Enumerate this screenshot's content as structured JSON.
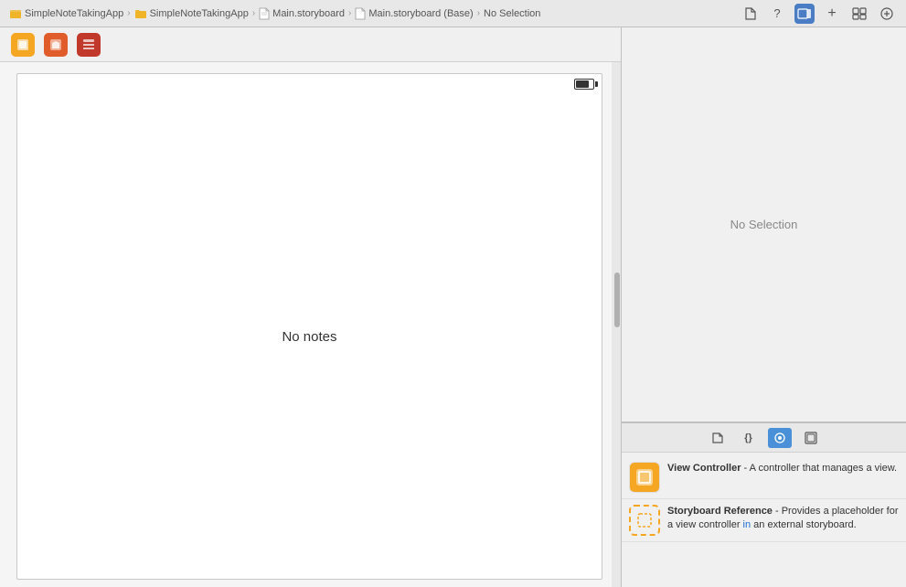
{
  "topBar": {
    "breadcrumb": [
      {
        "label": "SimpleNoteTakingApp",
        "type": "app",
        "iconType": "folder"
      },
      {
        "label": "SimpleNoteTakingApp",
        "type": "folder",
        "iconType": "folder"
      },
      {
        "label": "Main.storyboard",
        "type": "file",
        "iconType": "file"
      },
      {
        "label": "Main.storyboard (Base)",
        "type": "file",
        "iconType": "file"
      },
      {
        "label": "No Selection",
        "type": "text",
        "iconType": "none"
      }
    ],
    "buttons": [
      {
        "icon": "□",
        "label": "new-file",
        "active": false
      },
      {
        "icon": "?",
        "label": "help",
        "active": false
      },
      {
        "icon": "≡",
        "label": "inspector-toggle",
        "active": true
      },
      {
        "icon": "+",
        "label": "add",
        "active": false
      },
      {
        "icon": "⊞",
        "label": "library",
        "active": false
      },
      {
        "icon": "⊕",
        "label": "zoom",
        "active": false
      }
    ]
  },
  "storyboard": {
    "toolbar": {
      "icons": [
        {
          "color": "#f5a623",
          "symbol": "⬤",
          "label": "view-controller-icon"
        },
        {
          "color": "#e05c2a",
          "symbol": "◼",
          "label": "nav-controller-icon"
        },
        {
          "color": "#c0392b",
          "symbol": "▣",
          "label": "tab-controller-icon"
        }
      ]
    },
    "canvas": {
      "noNotesText": "No notes",
      "batteryVisible": true
    }
  },
  "inspector": {
    "noSelectionText": "No Selection"
  },
  "library": {
    "tabs": [
      {
        "icon": "□",
        "label": "objects-tab",
        "active": false
      },
      {
        "icon": "{ }",
        "label": "classes-tab",
        "active": false
      },
      {
        "icon": "◎",
        "label": "scenes-tab",
        "active": true
      },
      {
        "icon": "⊡",
        "label": "snippets-tab",
        "active": false
      }
    ],
    "items": [
      {
        "title": "View Controller",
        "description": "A controller that manages a view.",
        "iconType": "solid",
        "iconColor": "#f5a623",
        "label": "view-controller-item"
      },
      {
        "title": "Storyboard Reference",
        "description": "Provides a placeholder for a view controller in an external storyboard.",
        "iconType": "dashed",
        "iconColor": "#f5a623",
        "label": "storyboard-reference-item",
        "highlightWord": "in"
      }
    ]
  }
}
